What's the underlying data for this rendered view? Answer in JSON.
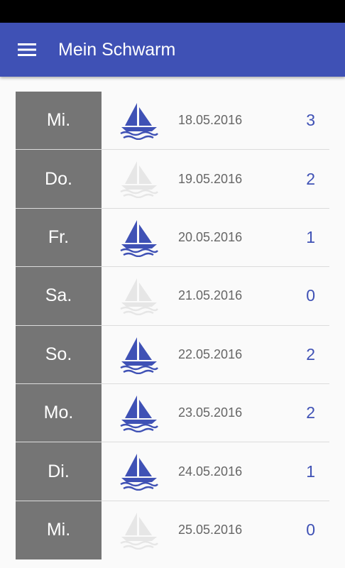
{
  "app": {
    "title": "Mein Schwarm",
    "menu_icon": "hamburger-menu-icon",
    "accent_color": "#3f51b5",
    "active_icon_color": "#3f51b5",
    "inactive_icon_color": "#e6e6e6"
  },
  "rows": [
    {
      "day": "Mi.",
      "date": "18.05.2016",
      "count": "3",
      "icon": "sailboat-icon",
      "active": true
    },
    {
      "day": "Do.",
      "date": "19.05.2016",
      "count": "2",
      "icon": "sailboat-icon",
      "active": false
    },
    {
      "day": "Fr.",
      "date": "20.05.2016",
      "count": "1",
      "icon": "sailboat-icon",
      "active": true
    },
    {
      "day": "Sa.",
      "date": "21.05.2016",
      "count": "0",
      "icon": "sailboat-icon",
      "active": false
    },
    {
      "day": "So.",
      "date": "22.05.2016",
      "count": "2",
      "icon": "sailboat-icon",
      "active": true
    },
    {
      "day": "Mo.",
      "date": "23.05.2016",
      "count": "2",
      "icon": "sailboat-icon",
      "active": true
    },
    {
      "day": "Di.",
      "date": "24.05.2016",
      "count": "1",
      "icon": "sailboat-icon",
      "active": true
    },
    {
      "day": "Mi.",
      "date": "25.05.2016",
      "count": "0",
      "icon": "sailboat-icon",
      "active": false
    }
  ]
}
